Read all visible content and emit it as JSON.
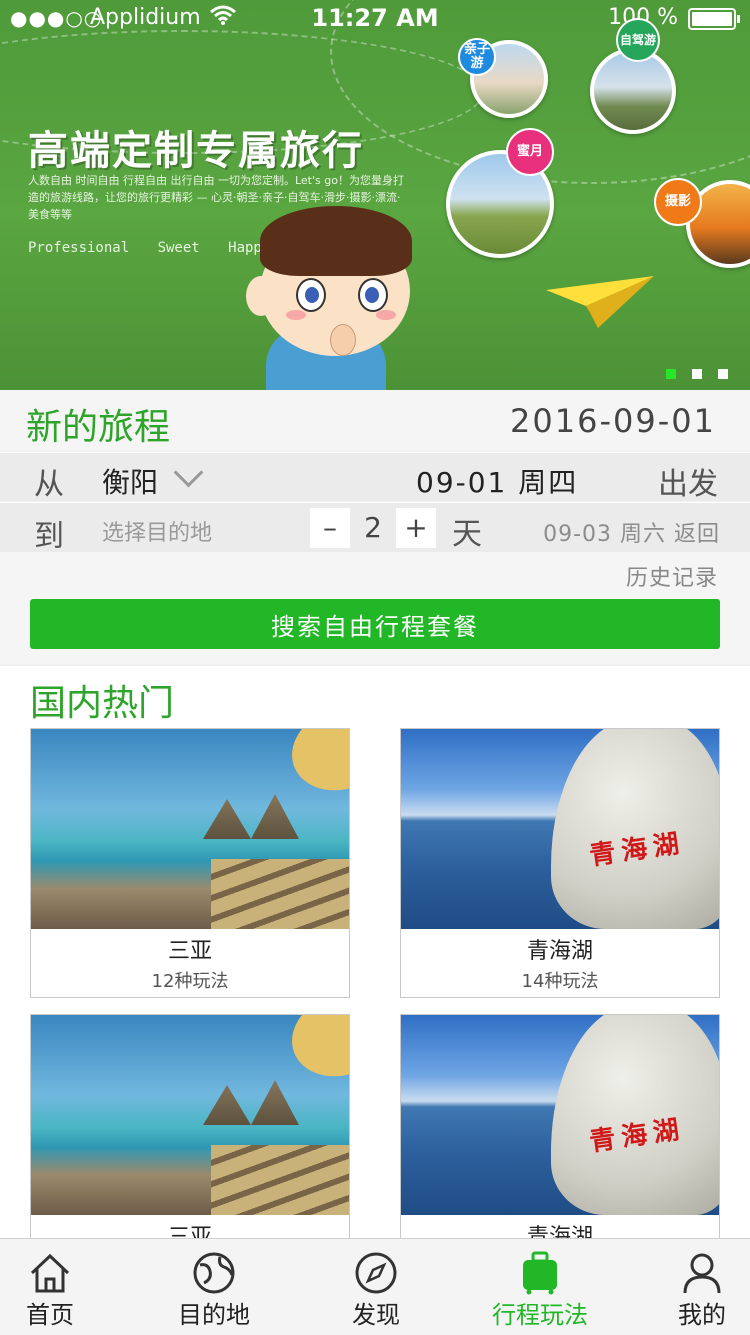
{
  "status_bar": {
    "signal": "●●●○○",
    "carrier": "Applidium",
    "time": "11:27 AM",
    "battery": "100 %"
  },
  "banner": {
    "title": "高端定制专属旅行",
    "subtitle": "人数自由 时间自由 行程自由 出行自由 一切为您定制。Let's go！为您量身打造的旅游线路，让您的旅行更精彩 — 心灵·朝圣·亲子·自驾车·滑步·摄影·漂流·美食等等",
    "words": "Professional Sweet Happy",
    "tags": [
      "亲子游",
      "自驾游",
      "蜜月",
      "摄影"
    ],
    "page_count": 3,
    "active_page": 1
  },
  "trip": {
    "title": "新的旅程",
    "date": "2016-09-01",
    "from_label": "从",
    "from_city": "衡阳",
    "depart_date": "09-01 周四",
    "depart_label": "出发",
    "to_label": "到",
    "dest_placeholder": "选择目的地",
    "minus": "–",
    "days": "2",
    "plus": "+",
    "days_unit": "天",
    "return_text": "09-03 周六 返回",
    "history": "历史记录",
    "search_button": "搜索自由行程套餐"
  },
  "hot": {
    "title": "国内热门",
    "cards": [
      {
        "name": "三亚",
        "count": "12种玩法"
      },
      {
        "name": "青海湖",
        "count": "14种玩法"
      },
      {
        "name": "三亚",
        "count": ""
      },
      {
        "name": "青海湖",
        "count": ""
      }
    ],
    "rock_text": "青海湖"
  },
  "tabbar": {
    "items": [
      {
        "label": "首页",
        "icon": "home-icon"
      },
      {
        "label": "目的地",
        "icon": "globe-icon"
      },
      {
        "label": "发现",
        "icon": "compass-icon"
      },
      {
        "label": "行程玩法",
        "icon": "luggage-icon"
      },
      {
        "label": "我的",
        "icon": "user-icon"
      }
    ],
    "active_index": 3,
    "active_color": "#21b727"
  },
  "colors": {
    "brand_green": "#21b727",
    "title_green": "#2ea42a",
    "banner_green": "#5aa641"
  }
}
